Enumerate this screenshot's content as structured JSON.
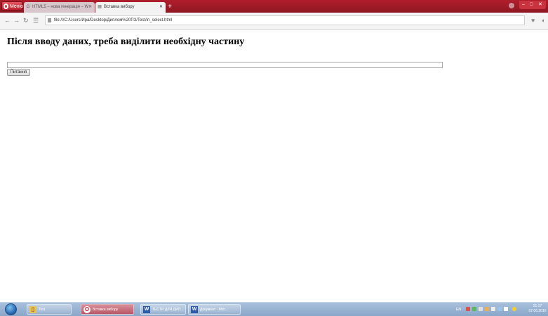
{
  "browser": {
    "menu_label": "Меню",
    "tabs": [
      {
        "label": "HTML5 – нова генерація – W",
        "favicon": "G",
        "active": false
      },
      {
        "label": "Вставка вибору",
        "favicon": "▤",
        "active": true
      }
    ],
    "new_tab": "+",
    "address_url": "file:///C:/Users/Ира/Desktop/Диплом%20ПЗ/Test/in_select.html",
    "accent": "#a51c29"
  },
  "page": {
    "heading": "Після вводу даних, треба виділити необхідну частину",
    "answer_value": "",
    "ask_button": "Питання"
  },
  "taskbar": {
    "items": [
      {
        "label": "Test",
        "icon": "folder-icon"
      },
      {
        "label": "Вставка вибору",
        "icon": "opera-icon"
      },
      {
        "label": "ТЕСТИ ДЛЯ ДИП...",
        "icon": "word-icon"
      },
      {
        "label": "Документ - Micr...",
        "icon": "word-icon"
      }
    ],
    "language": "EN",
    "time": "21:17",
    "date": "07.06.2016"
  }
}
